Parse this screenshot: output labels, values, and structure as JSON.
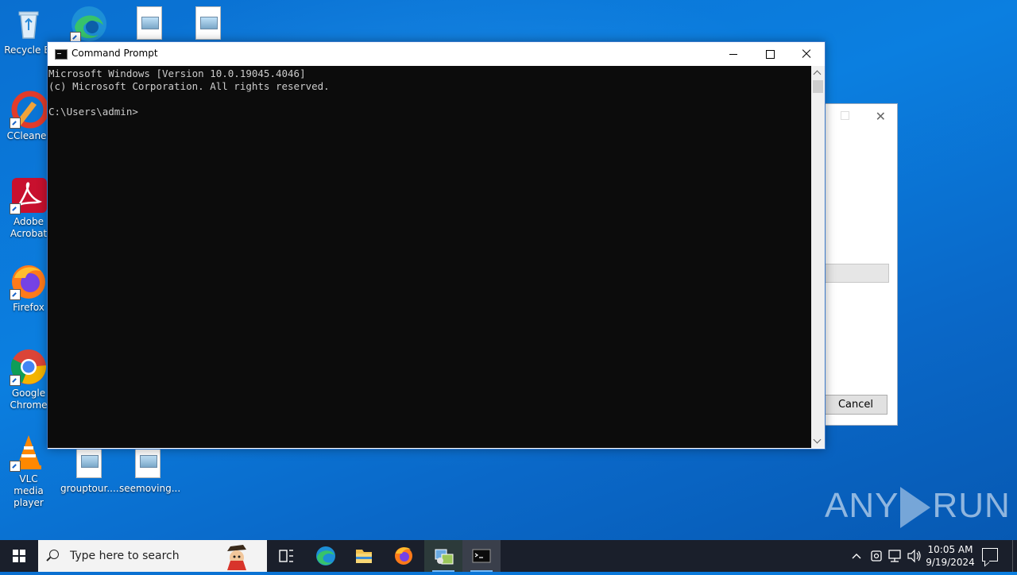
{
  "desktop": {
    "icons": [
      {
        "label": "Recycle Bi",
        "icon": "recycle-bin-icon"
      },
      {
        "label": "CCleaner",
        "icon": "ccleaner-icon"
      },
      {
        "label": "Adobe Acrobat",
        "icon": "adobe-acrobat-icon"
      },
      {
        "label": "Firefox",
        "icon": "firefox-icon"
      },
      {
        "label": "Google Chrome",
        "icon": "chrome-icon"
      },
      {
        "label": "VLC media player",
        "icon": "vlc-icon"
      },
      {
        "label": "grouptour....",
        "icon": "image-file-icon"
      },
      {
        "label": "seemoving...",
        "icon": "image-file-icon"
      }
    ]
  },
  "cmd_window": {
    "title": "Command Prompt",
    "lines": [
      "Microsoft Windows [Version 10.0.19045.4046]",
      "(c) Microsoft Corporation. All rights reserved.",
      "",
      "C:\\Users\\admin>"
    ]
  },
  "background_dialog": {
    "cancel_label": "Cancel"
  },
  "watermark": {
    "left": "ANY",
    "right": "RUN"
  },
  "taskbar": {
    "search_placeholder": "Type here to search",
    "apps": [
      "task-view-icon",
      "edge-icon",
      "file-explorer-icon",
      "firefox-icon",
      "installer-icon",
      "command-prompt-icon"
    ],
    "active_app": "command-prompt-icon",
    "clock_time": "10:05 AM",
    "clock_date": "9/19/2024"
  },
  "colors": {
    "desktop": "#0a78d8",
    "taskbar": "#1a1f2b",
    "console_bg": "#0c0c0c",
    "console_fg": "#cccccc"
  }
}
